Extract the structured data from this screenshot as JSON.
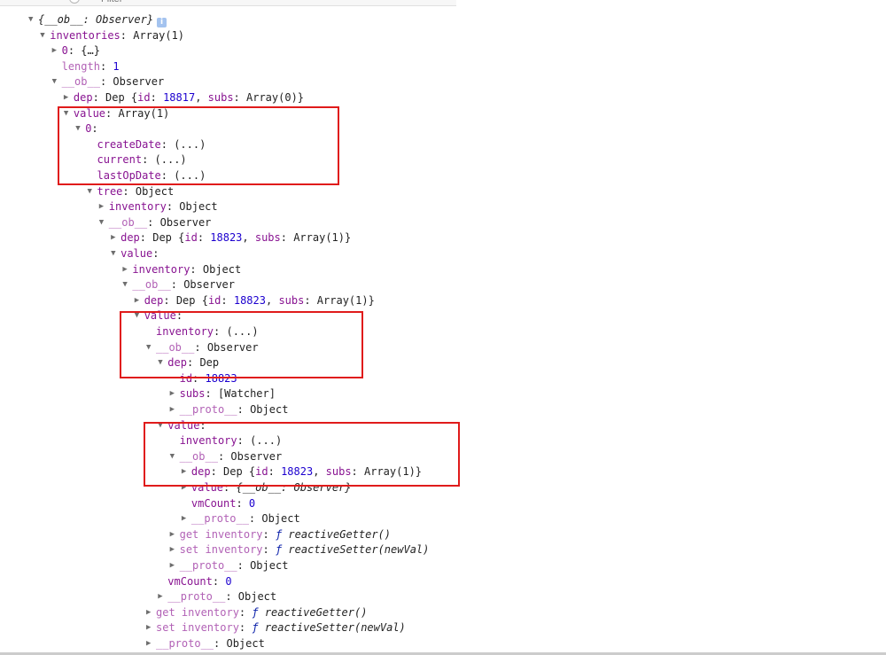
{
  "filter": {
    "placeholder": "Filter"
  },
  "tree": [
    {
      "d": 0,
      "t": "down",
      "k": "{__ob__: Observer}",
      "kind": "root",
      "info": true
    },
    {
      "d": 1,
      "t": "down",
      "k": "inventories",
      "v": "Array(1)"
    },
    {
      "d": 2,
      "t": "right",
      "k": "0",
      "v": "{…}"
    },
    {
      "d": 2,
      "t": "",
      "k": "length",
      "v": "1",
      "num": true,
      "dim": true
    },
    {
      "d": 2,
      "t": "down",
      "k": "__ob__",
      "v": "Observer",
      "dim": true
    },
    {
      "d": 3,
      "t": "right",
      "k": "dep",
      "v": "Dep {id: 18817, subs: Array(0)}",
      "dep": "18817",
      "subs": "Array(0)"
    },
    {
      "d": 3,
      "t": "down",
      "k": "value",
      "v": "Array(1)"
    },
    {
      "d": 4,
      "t": "down",
      "k": "0",
      "v": ""
    },
    {
      "d": 5,
      "t": "",
      "k": "createDate",
      "v": "(...)"
    },
    {
      "d": 5,
      "t": "",
      "k": "current",
      "v": "(...)"
    },
    {
      "d": 5,
      "t": "",
      "k": "lastOpDate",
      "v": "(...)"
    },
    {
      "d": 5,
      "t": "down",
      "k": "tree",
      "v": "Object"
    },
    {
      "d": 6,
      "t": "right",
      "k": "inventory",
      "v": "Object"
    },
    {
      "d": 6,
      "t": "down",
      "k": "__ob__",
      "v": "Observer",
      "dim": true
    },
    {
      "d": 7,
      "t": "right",
      "k": "dep",
      "v": "Dep {id: 18823, subs: Array(1)}",
      "dep": "18823",
      "subs": "Array(1)"
    },
    {
      "d": 7,
      "t": "down",
      "k": "value",
      "v": ""
    },
    {
      "d": 8,
      "t": "right",
      "k": "inventory",
      "v": "Object"
    },
    {
      "d": 8,
      "t": "down",
      "k": "__ob__",
      "v": "Observer",
      "dim": true
    },
    {
      "d": 9,
      "t": "right",
      "k": "dep",
      "v": "Dep {id: 18823, subs: Array(1)}",
      "dep": "18823",
      "subs": "Array(1)"
    },
    {
      "d": 9,
      "t": "down",
      "k": "value",
      "v": ""
    },
    {
      "d": 10,
      "t": "",
      "k": "inventory",
      "v": "(...)"
    },
    {
      "d": 10,
      "t": "down",
      "k": "__ob__",
      "v": "Observer",
      "dim": true
    },
    {
      "d": 11,
      "t": "down",
      "k": "dep",
      "v": "Dep"
    },
    {
      "d": 12,
      "t": "",
      "k": "id",
      "v": "18823",
      "num": true
    },
    {
      "d": 12,
      "t": "right",
      "k": "subs",
      "v": "[Watcher]"
    },
    {
      "d": 12,
      "t": "right",
      "k": "__proto__",
      "v": "Object",
      "dim": true
    },
    {
      "d": 11,
      "t": "down",
      "k": "value",
      "v": ""
    },
    {
      "d": 12,
      "t": "",
      "k": "inventory",
      "v": "(...)"
    },
    {
      "d": 12,
      "t": "down",
      "k": "__ob__",
      "v": "Observer",
      "dim": true
    },
    {
      "d": 13,
      "t": "right",
      "k": "dep",
      "v": "Dep {id: 18823, subs: Array(1)}",
      "dep": "18823",
      "subs": "Array(1)"
    },
    {
      "d": 13,
      "t": "right",
      "k": "value",
      "v": "{__ob__: Observer}",
      "it": true
    },
    {
      "d": 13,
      "t": "",
      "k": "vmCount",
      "v": "0",
      "num": true
    },
    {
      "d": 13,
      "t": "right",
      "k": "__proto__",
      "v": "Object",
      "dim": true
    },
    {
      "d": 12,
      "t": "right",
      "k": "get inventory",
      "v": "reactiveGetter()",
      "fn": true,
      "dim": true
    },
    {
      "d": 12,
      "t": "right",
      "k": "set inventory",
      "v": "reactiveSetter(newVal)",
      "fn": true,
      "dim": true
    },
    {
      "d": 12,
      "t": "right",
      "k": "__proto__",
      "v": "Object",
      "dim": true
    },
    {
      "d": 11,
      "t": "",
      "k": "vmCount",
      "v": "0",
      "num": true
    },
    {
      "d": 11,
      "t": "right",
      "k": "__proto__",
      "v": "Object",
      "dim": true
    },
    {
      "d": 10,
      "t": "right",
      "k": "get inventory",
      "v": "reactiveGetter()",
      "fn": true,
      "dim": true
    },
    {
      "d": 10,
      "t": "right",
      "k": "set inventory",
      "v": "reactiveSetter(newVal)",
      "fn": true,
      "dim": true
    },
    {
      "d": 10,
      "t": "right",
      "k": "__proto__",
      "v": "Object",
      "dim": true
    }
  ],
  "colors": {
    "highlight": "#e01b1b",
    "key": "#881391",
    "number": "#1c00cf",
    "function": "#0d22aa"
  }
}
